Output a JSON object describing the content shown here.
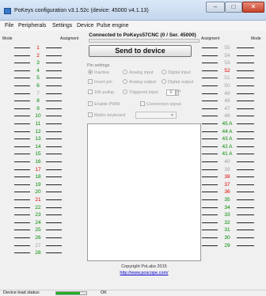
{
  "window": {
    "title": "PoKeys configuration v3.1.52c (device: 45000 v4.1.13)",
    "close_glyph": "✕",
    "minimize_glyph": "–",
    "maximize_glyph": "□"
  },
  "menu": [
    "File",
    "Peripherals",
    "Settings",
    "Device",
    "Pulse engine"
  ],
  "columns": {
    "left_mode": "Mode",
    "left_assignment": "Assigment",
    "right_assignment": "Assigment",
    "right_mode": "Mode"
  },
  "connection": {
    "label": "Connected to PoKeys57CNC (0 / Ser. 45000)",
    "send_button": "Send to device"
  },
  "pin_settings": {
    "legend": "Pin settings",
    "inactive": "Inactive",
    "analog_input": "Analog input",
    "digital_input": "Digital input",
    "invert_pin": "Invert pin",
    "analog_output": "Analog output",
    "digital_output": "Digital output",
    "pullup_10k": "10k pullup",
    "triggered_input": "Triggered input",
    "trigger_value": "0",
    "enable_pwm": "Enable PWM",
    "connection_signal": "Connection signal",
    "matrix_keyboard": "Matrix keyboard",
    "combo_arrow": "▼",
    "spin_arrows": "▲▼"
  },
  "footer": {
    "copyright": "Copyright PoLabs 2015",
    "link": "http://www.poscope.com/"
  },
  "status": {
    "label": "Device load status:",
    "progress": 0.8,
    "text": "OK"
  },
  "colors": {
    "red": "#e00000",
    "green": "#008a00",
    "gray": "#a0a0a0"
  },
  "left_pins": [
    {
      "num": "1",
      "color": "red"
    },
    {
      "num": "2",
      "color": "red"
    },
    {
      "num": "3",
      "color": "green"
    },
    {
      "num": "4",
      "color": "green"
    },
    {
      "num": "5",
      "color": "green"
    },
    {
      "num": "6",
      "color": "green"
    },
    {
      "num": "7",
      "color": "gray"
    },
    {
      "num": "8",
      "color": "green"
    },
    {
      "num": "9",
      "color": "green"
    },
    {
      "num": "10",
      "color": "green"
    },
    {
      "num": "11",
      "color": "green"
    },
    {
      "num": "12",
      "color": "green"
    },
    {
      "num": "13",
      "color": "green"
    },
    {
      "num": "14",
      "color": "green"
    },
    {
      "num": "15",
      "color": "green"
    },
    {
      "num": "16",
      "color": "green"
    },
    {
      "num": "17",
      "color": "red"
    },
    {
      "num": "18",
      "color": "green"
    },
    {
      "num": "19",
      "color": "green"
    },
    {
      "num": "20",
      "color": "green"
    },
    {
      "num": "21",
      "color": "red"
    },
    {
      "num": "22",
      "color": "green"
    },
    {
      "num": "23",
      "color": "green"
    },
    {
      "num": "24",
      "color": "green"
    },
    {
      "num": "25",
      "color": "green"
    },
    {
      "num": "26",
      "color": "green"
    },
    {
      "num": "27",
      "color": "gray"
    },
    {
      "num": "28",
      "color": "green"
    }
  ],
  "right_pins": [
    {
      "num": "55",
      "color": "gray"
    },
    {
      "num": "54",
      "color": "gray"
    },
    {
      "num": "53",
      "color": "gray"
    },
    {
      "num": "52",
      "color": "red"
    },
    {
      "num": "51",
      "color": "gray"
    },
    {
      "num": "50",
      "color": "gray"
    },
    {
      "num": "49",
      "color": "gray"
    },
    {
      "num": "48",
      "color": "gray"
    },
    {
      "num": "47",
      "color": "gray"
    },
    {
      "num": "46",
      "color": "gray"
    },
    {
      "num": "45 A",
      "color": "green"
    },
    {
      "num": "44 A",
      "color": "green"
    },
    {
      "num": "43 A",
      "color": "green"
    },
    {
      "num": "42 A",
      "color": "green"
    },
    {
      "num": "41 A",
      "color": "green"
    },
    {
      "num": "40",
      "color": "gray"
    },
    {
      "num": "39",
      "color": "gray"
    },
    {
      "num": "38",
      "color": "red"
    },
    {
      "num": "37",
      "color": "red"
    },
    {
      "num": "36",
      "color": "red"
    },
    {
      "num": "35",
      "color": "green"
    },
    {
      "num": "34",
      "color": "green"
    },
    {
      "num": "33",
      "color": "green"
    },
    {
      "num": "32",
      "color": "green"
    },
    {
      "num": "31",
      "color": "green"
    },
    {
      "num": "30",
      "color": "green"
    },
    {
      "num": "29",
      "color": "green"
    }
  ]
}
